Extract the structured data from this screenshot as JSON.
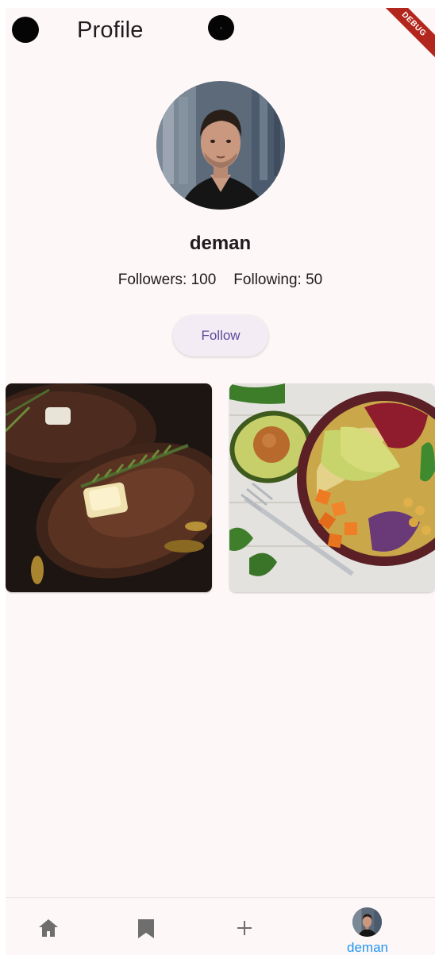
{
  "app_bar": {
    "title": "Profile",
    "debug_banner": "DEBUG"
  },
  "profile": {
    "username": "deman",
    "followers_label": "Followers: 100",
    "following_label": "Following: 50",
    "follow_button_label": "Follow"
  },
  "posts": [
    {
      "subject": "steak"
    },
    {
      "subject": "salad-bowl"
    }
  ],
  "bottom_nav": {
    "items": [
      {
        "icon": "home-icon"
      },
      {
        "icon": "bookmark-icon"
      },
      {
        "icon": "add-icon"
      },
      {
        "icon": "avatar",
        "label": "deman"
      }
    ],
    "active_color": "#2196f3",
    "inactive_color": "#6e6e6e"
  },
  "colors": {
    "background": "#fdf7f7",
    "button_bg": "#f3ecf4",
    "button_text": "#5b4a9b",
    "debug_ribbon": "#b3261e"
  }
}
